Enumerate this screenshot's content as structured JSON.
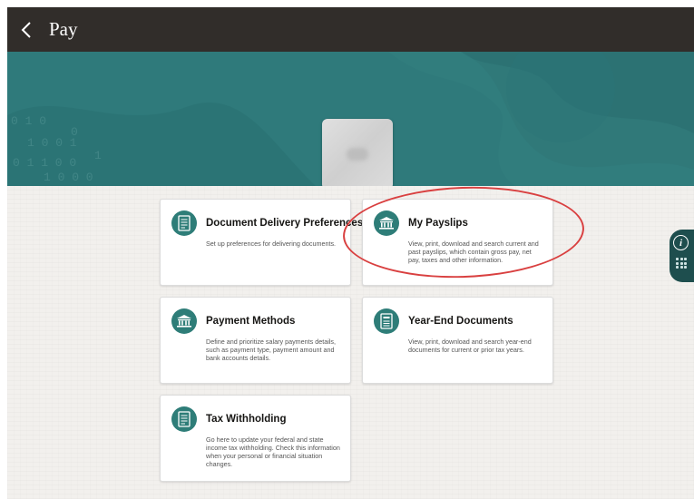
{
  "header": {
    "title": "Pay",
    "back_icon": "chevron-left-icon"
  },
  "profile": {
    "name": "",
    "photo_icon": "profile-photo"
  },
  "cards": [
    {
      "id": "document-delivery",
      "title": "Document Delivery Preferences",
      "description": "Set up preferences for delivering documents.",
      "icon": "document-icon"
    },
    {
      "id": "my-payslips",
      "title": "My Payslips",
      "description": "View, print, download and search current and past payslips, which contain gross pay, net pay, taxes and other information.",
      "icon": "bank-icon",
      "highlighted": true
    },
    {
      "id": "payment-methods",
      "title": "Payment Methods",
      "description": "Define and prioritize salary payments details, such as payment type, payment amount and bank accounts details.",
      "icon": "bank-icon"
    },
    {
      "id": "year-end-documents",
      "title": "Year-End Documents",
      "description": "View, print, download and search year-end documents for current or prior tax years.",
      "icon": "document-stack-icon"
    },
    {
      "id": "tax-withholding",
      "title": "Tax Withholding",
      "description": "Go here to update your federal and state income tax withholding. Check this information when your personal or financial situation changes.",
      "icon": "document-icon"
    }
  ],
  "side_panel": {
    "info_label": "i",
    "info_icon": "info-icon",
    "apps_icon": "grid-icon"
  },
  "colors": {
    "topbar": "#312d2a",
    "hero": "#2f7a7b",
    "icon_circle": "#2e7d78",
    "highlight_oval": "#d94040"
  }
}
